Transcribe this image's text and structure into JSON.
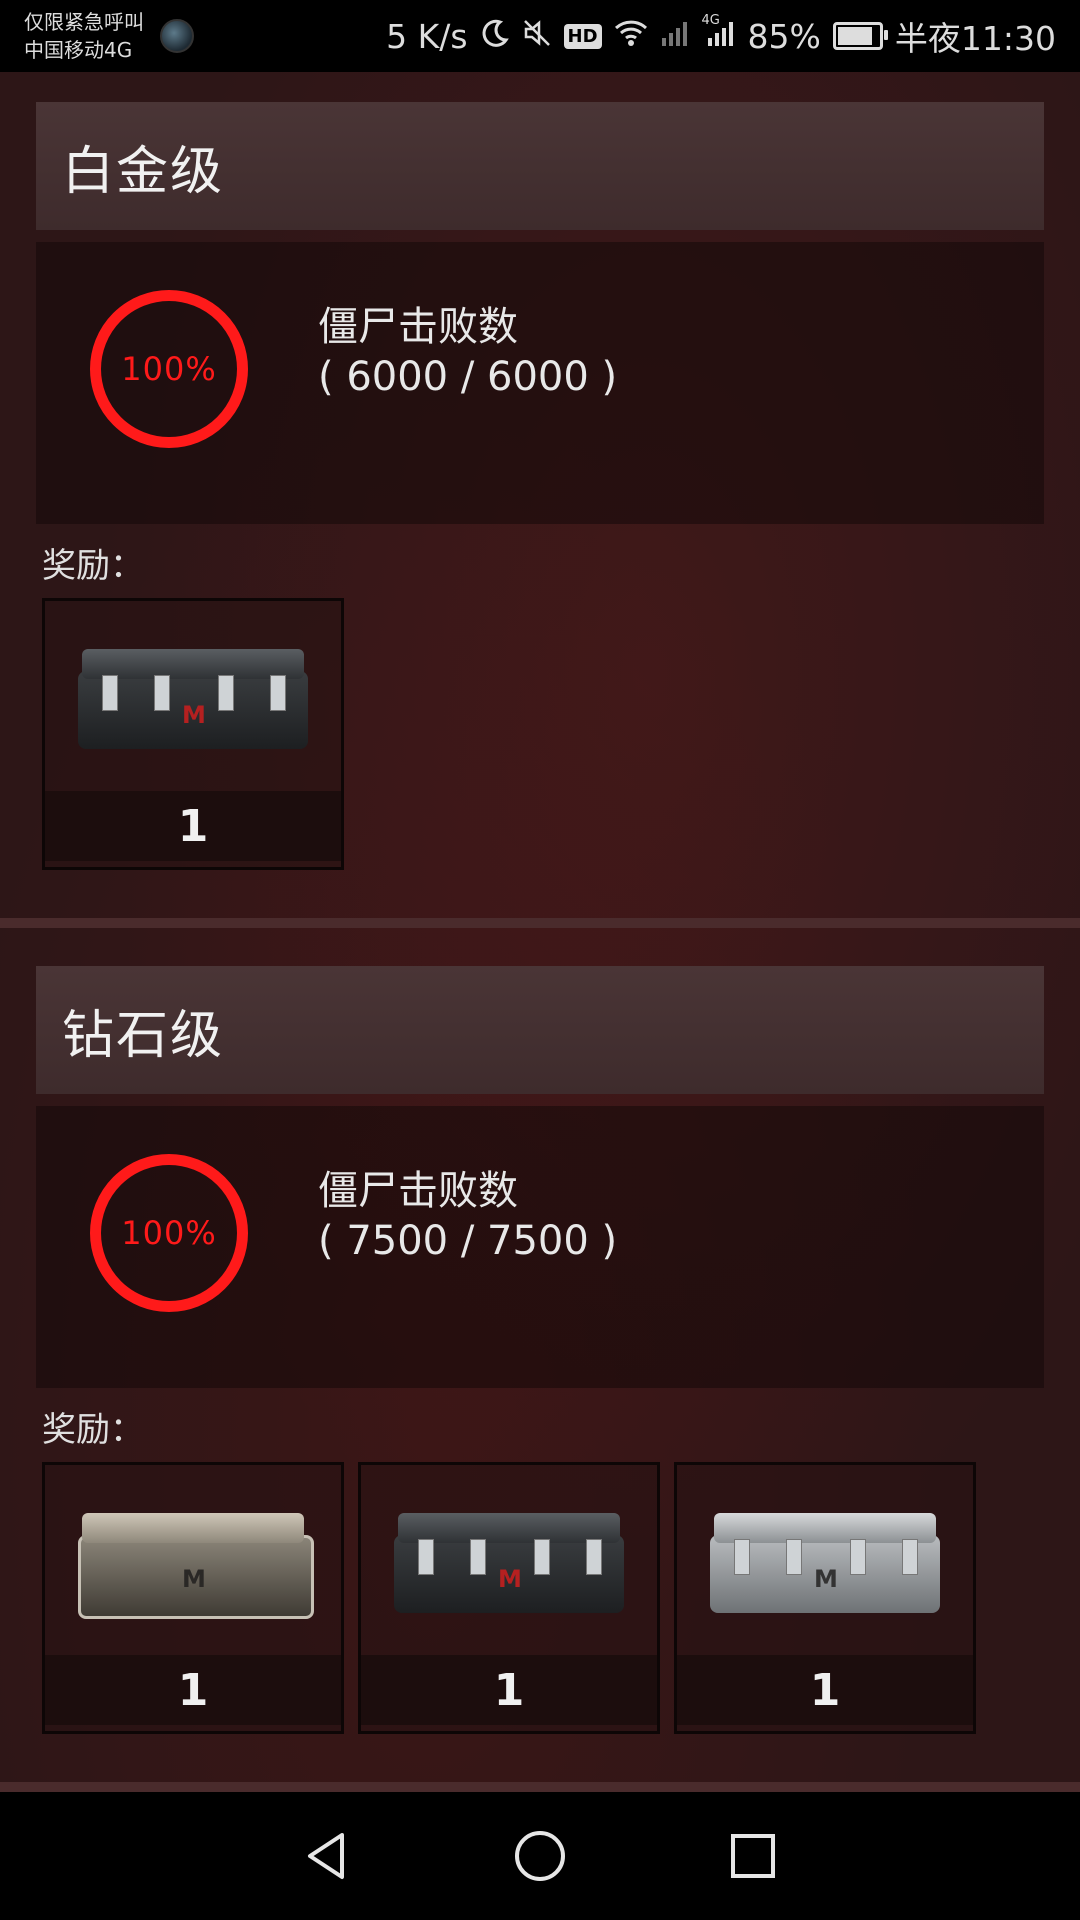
{
  "status_bar": {
    "carrier_line1": "仅限紧急呼叫",
    "carrier_line2": "中国移动4G",
    "speed": "5 K/s",
    "hd_badge": "HD",
    "network_type": "4G",
    "battery": "85%",
    "battery_level": 0.85,
    "time": "半夜11:30",
    "icons": [
      "moon-icon",
      "mute-icon",
      "hd-icon",
      "wifi-icon",
      "no-signal-icon",
      "signal-icon",
      "battery-icon"
    ]
  },
  "tiers": [
    {
      "title": "白金级",
      "progress_text": "100%",
      "progress": 1.0,
      "task_name": "僵尸击败数",
      "task_count": "( 6000 / 6000 )",
      "reward_label": "奖励：",
      "rewards": [
        {
          "icon": "black-crate-icon",
          "qty": "1"
        }
      ]
    },
    {
      "title": "钻石级",
      "progress_text": "100%",
      "progress": 1.0,
      "task_name": "僵尸击败数",
      "task_count": "( 7500 / 7500 )",
      "reward_label": "奖励：",
      "rewards": [
        {
          "icon": "wooden-crate-icon",
          "qty": "1"
        },
        {
          "icon": "black-crate-icon",
          "qty": "1"
        },
        {
          "icon": "silver-crate-icon",
          "qty": "1"
        }
      ]
    }
  ],
  "colors": {
    "accent": "#ff1a1a",
    "background": "#2d1617",
    "header": "#4a3536"
  },
  "nav_bar": {
    "icons": [
      "back-icon",
      "home-icon",
      "recents-icon"
    ]
  }
}
